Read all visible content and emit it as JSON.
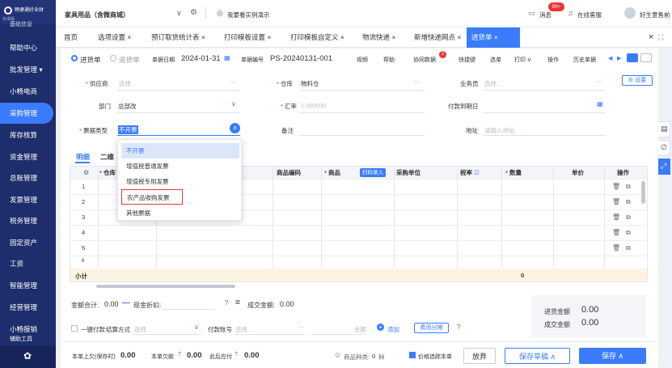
{
  "sidebar": {
    "brand_name": "畅捷通好业财",
    "brand_sub": "标准版",
    "items": [
      {
        "label": "基础信息"
      },
      {
        "label": "帮助中心"
      },
      {
        "label": "批发管理 ▾"
      },
      {
        "label": "小畅电商"
      },
      {
        "label": "采购管理"
      },
      {
        "label": "库存核算"
      },
      {
        "label": "资金管理"
      },
      {
        "label": "总账管理"
      },
      {
        "label": "发票管理"
      },
      {
        "label": "税务管理"
      },
      {
        "label": "固定资产"
      },
      {
        "label": "工资"
      },
      {
        "label": "智能管理"
      },
      {
        "label": "经营管理"
      },
      {
        "label": "小畅报销"
      },
      {
        "label": "辅助工具"
      }
    ]
  },
  "topbar": {
    "company": "家具用品（含微商城）",
    "demo_link": "我要看实例演示",
    "message_label": "消息",
    "message_badge": "99+",
    "support_label": "在线客服",
    "user_label": "好生意售前"
  },
  "tabs": [
    {
      "label": "首页"
    },
    {
      "label": "选项设置 ×"
    },
    {
      "label": "预订取货统计表 ×"
    },
    {
      "label": "打印模板设置 ×"
    },
    {
      "label": "打印模板自定义 ×"
    },
    {
      "label": "物流快递 ×"
    },
    {
      "label": "新增快递网点 ×"
    },
    {
      "label": "进货单 ×"
    }
  ],
  "tabs_close": "×",
  "form": {
    "radio_in": "进货单",
    "radio_out": "退货单",
    "date_label": "单据日期",
    "date_value": "2024-01-31",
    "no_label": "单据编号",
    "no_value": "PS-20240131-001",
    "toolbar": [
      "视频",
      "帮助",
      "协同数据",
      "快捷键",
      "选单",
      "打印 ∨",
      "操作",
      "历史单据"
    ],
    "toolbar_badge": "2",
    "supplier_label": "供应商",
    "supplier_ph": "选择...",
    "warehouse_label": "仓库",
    "warehouse_value": "物料仓",
    "clerk_label": "业务员",
    "clerk_ph": "选择...",
    "settings_btn": "设置",
    "dept_label": "部门",
    "dept_value": "总部改",
    "rate_label": "汇率",
    "rate_value": "1.000000",
    "due_label": "付款到期日",
    "invoice_label": "票据类型",
    "invoice_value": "不开票",
    "remark_label": "备注",
    "address_label": "地址",
    "address_ph": "请输入地址",
    "sub_tab_detail": "明细",
    "sub_tab_two": "二维"
  },
  "dropdown": {
    "options": [
      "不开票",
      "增值税普通发票",
      "增值税专用发票",
      "农产品收购发票",
      "其他票据"
    ]
  },
  "grid": {
    "headers": {
      "settings": "⚙",
      "warehouse": "仓库",
      "code": "商品编码",
      "product": "商品",
      "scan": "扫码录入",
      "unit": "采购单位",
      "tax": "税率",
      "qty": "数量",
      "price": "单价",
      "ops": "操作"
    },
    "rows": [
      "1",
      "2",
      "3",
      "4",
      "5",
      "6"
    ],
    "subtotal_label": "小计",
    "subtotal_qty": "0"
  },
  "totals": {
    "amount_label": "金额合计:",
    "amount_value": "0.00",
    "discount_label": "现金折扣:",
    "deal_label": "成交金额:",
    "deal_value": "0.00",
    "purchase_label": "进货金额",
    "purchase_value": "0.00",
    "deal2_label": "成交金额",
    "deal2_value": "0.00"
  },
  "payment": {
    "one_click": "一键付款",
    "method_label": "结算方式",
    "method_ph": "选择...",
    "account_label": "付款账号",
    "account_ph": "选择...",
    "amount_label": "金额",
    "add_label": "添加",
    "fee_label": "费用分摊"
  },
  "footer": {
    "prev_owed_label": "本单上欠(保存时)",
    "prev_owed_value": "0.00",
    "owed_label": "本单欠款",
    "owed_value": "0.00",
    "after_label": "此后应付",
    "after_value": "0.00",
    "kinds_label": "商品种类:",
    "kinds_value": "0",
    "kinds_unit": "种",
    "trace_label": "价格追踪本单",
    "discard": "放弃",
    "draft": "保存草稿 ∧",
    "save": "保存 ∧"
  },
  "colors": {
    "primary": "#3b7cff",
    "sidebar": "#1e2d6b",
    "accent_red": "#e33333"
  }
}
